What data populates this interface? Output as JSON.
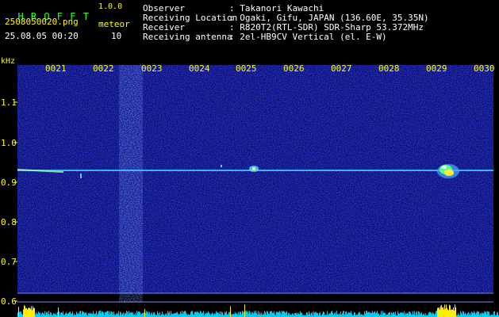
{
  "header": {
    "app_name": "H R O F F T",
    "version": "1.0.0",
    "filename": "2508050020.png",
    "timestamp": "25.08.05 00:20",
    "meteor_label": "meteor",
    "meteor_count": "10",
    "info": [
      {
        "label": "Observer",
        "value": ": Takanori Kawachi"
      },
      {
        "label": "Receiving Location",
        "value": ": Ogaki, Gifu, JAPAN (136.60E, 35.35N)"
      },
      {
        "label": "Receiver",
        "value": ": R820T2(RTL-SDR) SDR-Sharp 53.372MHz"
      },
      {
        "label": "Receiving antenna",
        "value": ": 2el-HB9CV Vertical (el. E-W)"
      }
    ]
  },
  "axis": {
    "unit": "kHz",
    "time_ticks": [
      "0021",
      "0022",
      "0023",
      "0024",
      "0025",
      "0026",
      "0027",
      "0028",
      "0029",
      "0030"
    ],
    "freq_ticks": [
      "1.1",
      "1.0",
      "0.9",
      "0.8",
      "0.7",
      "0.6"
    ]
  },
  "colors": {
    "background": "#000000",
    "waterfall_base": "#0a0a78",
    "signal_line": "#44ccff",
    "tick_label": "#ffff00",
    "info_text": "#ffffff",
    "title": "#33ff33",
    "power_bar": "#00ccee"
  }
}
